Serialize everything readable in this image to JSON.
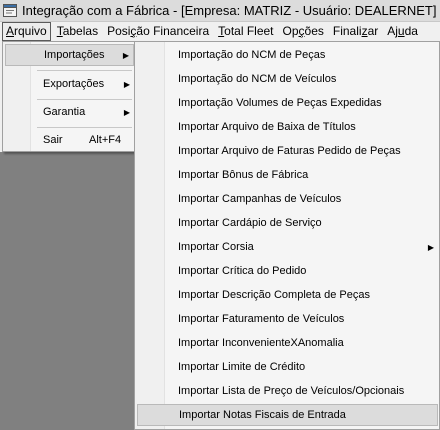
{
  "window": {
    "title": "Integração com a Fábrica - [Empresa: MATRIZ - Usuário: DEALERNET]",
    "icon": "app-icon"
  },
  "menubar": {
    "items": [
      {
        "label": "Arquivo",
        "ul": "A",
        "rest": "rquivo"
      },
      {
        "label": "Tabelas",
        "ul": "T",
        "rest": "abelas"
      },
      {
        "label": "Posição Financeira",
        "pre": "Posi",
        "ul": "ç",
        "rest": "ão Financeira"
      },
      {
        "label": "Total Fleet",
        "ul": "T",
        "rest": "otal Fleet"
      },
      {
        "label": "Opções",
        "pre": "Op",
        "ul": "ç",
        "rest": "ões"
      },
      {
        "label": "Finalizar",
        "pre": "Finali",
        "ul": "z",
        "rest": "ar"
      },
      {
        "label": "Ajuda",
        "pre": "Aj",
        "ul": "u",
        "rest": "da"
      }
    ]
  },
  "arquivo_menu": {
    "items": [
      {
        "label": "Importações",
        "submenu": true
      },
      {
        "label": "Exportações",
        "submenu": true
      },
      {
        "label": "Garantia",
        "submenu": true
      },
      {
        "label": "Sair",
        "accelerator": "Alt+F4"
      }
    ]
  },
  "importacoes_menu": {
    "items": [
      {
        "label": "Importação do NCM de Peças"
      },
      {
        "label": "Importação do NCM de Veículos"
      },
      {
        "label": "Importação Volumes de Peças Expedidas"
      },
      {
        "label": "Importar Arquivo de Baixa de Títulos"
      },
      {
        "label": "Importar Arquivo de Faturas Pedido de Peças"
      },
      {
        "label": "Importar Bônus de Fábrica"
      },
      {
        "label": "Importar Campanhas de Veículos"
      },
      {
        "label": "Importar Cardápio de Serviço"
      },
      {
        "label": "Importar Corsia",
        "submenu": true
      },
      {
        "label": "Importar Crítica do Pedido"
      },
      {
        "label": "Importar Descrição Completa de Peças"
      },
      {
        "label": "Importar Faturamento de Veículos"
      },
      {
        "label": "Importar InconvenienteXAnomalia"
      },
      {
        "label": "Importar Limite de Crédito"
      },
      {
        "label": "Importar Lista de Preço de Veículos/Opcionais"
      },
      {
        "label": "Importar Notas Fiscais de Entrada"
      }
    ]
  }
}
